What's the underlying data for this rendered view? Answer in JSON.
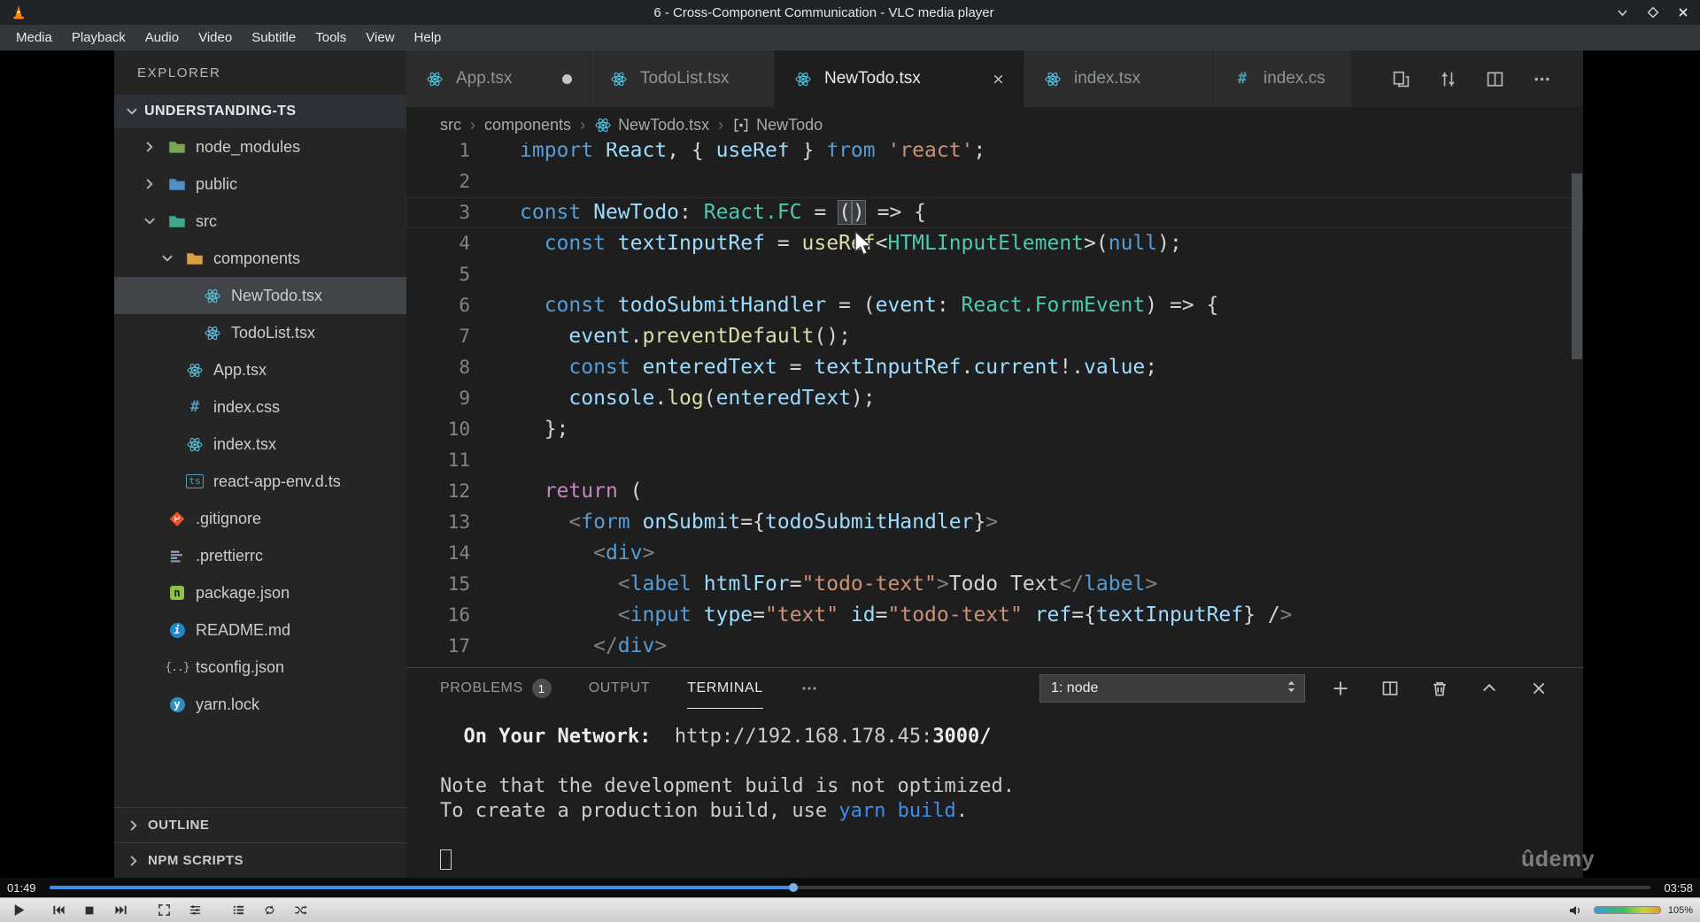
{
  "window": {
    "title": "6 - Cross-Component Communication - VLC media player",
    "buttons": [
      "minimize",
      "maximize",
      "close"
    ],
    "menus": [
      "Media",
      "Playback",
      "Audio",
      "Video",
      "Subtitle",
      "Tools",
      "View",
      "Help"
    ]
  },
  "explorer": {
    "title": "EXPLORER",
    "root": "UNDERSTANDING-TS",
    "items": [
      {
        "label": "node_modules",
        "icon": "folder-node",
        "chevron": "collapsed",
        "level": 0
      },
      {
        "label": "public",
        "icon": "folder-public",
        "chevron": "collapsed",
        "level": 0
      },
      {
        "label": "src",
        "icon": "folder-src",
        "chevron": "expanded",
        "level": 0
      },
      {
        "label": "components",
        "icon": "folder-components",
        "chevron": "expanded",
        "level": 1
      },
      {
        "label": "NewTodo.tsx",
        "icon": "react",
        "level": 2,
        "selected": true
      },
      {
        "label": "TodoList.tsx",
        "icon": "react",
        "level": 2
      },
      {
        "label": "App.tsx",
        "icon": "react",
        "level": 1
      },
      {
        "label": "index.css",
        "icon": "css",
        "level": 1
      },
      {
        "label": "index.tsx",
        "icon": "react",
        "level": 1
      },
      {
        "label": "react-app-env.d.ts",
        "icon": "ts",
        "level": 1
      },
      {
        "label": ".gitignore",
        "icon": "git",
        "level": 0
      },
      {
        "label": ".prettierrc",
        "icon": "prettier",
        "level": 0
      },
      {
        "label": "package.json",
        "icon": "npm",
        "level": 0
      },
      {
        "label": "README.md",
        "icon": "info",
        "level": 0
      },
      {
        "label": "tsconfig.json",
        "icon": "braces",
        "level": 0
      },
      {
        "label": "yarn.lock",
        "icon": "yarn",
        "level": 0
      }
    ],
    "sections": [
      "OUTLINE",
      "NPM SCRIPTS"
    ]
  },
  "tabs": [
    {
      "label": "App.tsx",
      "icon": "react",
      "modified": true
    },
    {
      "label": "TodoList.tsx",
      "icon": "react"
    },
    {
      "label": "NewTodo.tsx",
      "icon": "react",
      "active": true
    },
    {
      "label": "index.tsx",
      "icon": "react"
    },
    {
      "label": "index.cs",
      "icon": "css"
    }
  ],
  "editor_actions": [
    "open-changes-icon",
    "compare-changes-icon",
    "split-editor-icon",
    "more-actions-icon"
  ],
  "breadcrumb": [
    {
      "label": "src"
    },
    {
      "label": "components"
    },
    {
      "label": "NewTodo.tsx",
      "icon": "react"
    },
    {
      "label": "NewTodo",
      "icon": "symbol"
    }
  ],
  "breadcrumb_separator": "›",
  "code": [
    {
      "n": 1,
      "t": [
        [
          "k",
          "import "
        ],
        [
          "vr",
          "React"
        ],
        [
          "pl",
          ", { "
        ],
        [
          "vr",
          "useRef"
        ],
        [
          "pl",
          " } "
        ],
        [
          "k",
          "from"
        ],
        [
          "pl",
          " "
        ],
        [
          "st",
          "'react'"
        ],
        [
          "pl",
          ";"
        ]
      ]
    },
    {
      "n": 2,
      "t": []
    },
    {
      "n": 3,
      "cur": true,
      "t": [
        [
          "k",
          "const "
        ],
        [
          "vr",
          "NewTodo"
        ],
        [
          "pl",
          ": "
        ],
        [
          "ty",
          "React.FC"
        ],
        [
          "pl",
          " = "
        ],
        [
          "box",
          "("
        ],
        [
          "caret",
          ""
        ],
        [
          "box",
          ")"
        ],
        [
          "pl",
          " => {"
        ]
      ]
    },
    {
      "n": 4,
      "t": [
        [
          "pl",
          "  "
        ],
        [
          "k",
          "const "
        ],
        [
          "vr",
          "textInputRef"
        ],
        [
          "pl",
          " = "
        ],
        [
          "fn",
          "useRef"
        ],
        [
          "pl",
          "<"
        ],
        [
          "ty",
          "HTMLInputElement"
        ],
        [
          "pl",
          ">("
        ],
        [
          "k",
          "null"
        ],
        [
          "pl",
          ");"
        ]
      ]
    },
    {
      "n": 5,
      "t": []
    },
    {
      "n": 6,
      "t": [
        [
          "pl",
          "  "
        ],
        [
          "k",
          "const "
        ],
        [
          "vr",
          "todoSubmitHandler"
        ],
        [
          "pl",
          " = ("
        ],
        [
          "vr",
          "event"
        ],
        [
          "pl",
          ": "
        ],
        [
          "ty",
          "React.FormEvent"
        ],
        [
          "pl",
          ") => {"
        ]
      ]
    },
    {
      "n": 7,
      "t": [
        [
          "pl",
          "    "
        ],
        [
          "vr",
          "event"
        ],
        [
          "pl",
          "."
        ],
        [
          "fn",
          "preventDefault"
        ],
        [
          "pl",
          "();"
        ]
      ]
    },
    {
      "n": 8,
      "t": [
        [
          "pl",
          "    "
        ],
        [
          "k",
          "const "
        ],
        [
          "vr",
          "enteredText"
        ],
        [
          "pl",
          " = "
        ],
        [
          "vr",
          "textInputRef"
        ],
        [
          "pl",
          "."
        ],
        [
          "vr",
          "current"
        ],
        [
          "pl",
          "!."
        ],
        [
          "vr",
          "value"
        ],
        [
          "pl",
          ";"
        ]
      ]
    },
    {
      "n": 9,
      "t": [
        [
          "pl",
          "    "
        ],
        [
          "vr",
          "console"
        ],
        [
          "pl",
          "."
        ],
        [
          "fn",
          "log"
        ],
        [
          "pl",
          "("
        ],
        [
          "vr",
          "enteredText"
        ],
        [
          "pl",
          ");"
        ]
      ]
    },
    {
      "n": 10,
      "t": [
        [
          "pl",
          "  };"
        ]
      ]
    },
    {
      "n": 11,
      "t": []
    },
    {
      "n": 12,
      "t": [
        [
          "pl",
          "  "
        ],
        [
          "rt",
          "return"
        ],
        [
          "pl",
          " ("
        ]
      ]
    },
    {
      "n": 13,
      "t": [
        [
          "pl",
          "    "
        ],
        [
          "br",
          "<"
        ],
        [
          "tg",
          "form"
        ],
        [
          "pl",
          " "
        ],
        [
          "vr",
          "onSubmit"
        ],
        [
          "pl",
          "={"
        ],
        [
          "vr",
          "todoSubmitHandler"
        ],
        [
          "pl",
          "}"
        ],
        [
          "br",
          ">"
        ]
      ]
    },
    {
      "n": 14,
      "t": [
        [
          "pl",
          "      "
        ],
        [
          "br",
          "<"
        ],
        [
          "tg",
          "div"
        ],
        [
          "br",
          ">"
        ]
      ]
    },
    {
      "n": 15,
      "t": [
        [
          "pl",
          "        "
        ],
        [
          "br",
          "<"
        ],
        [
          "tg",
          "label"
        ],
        [
          "pl",
          " "
        ],
        [
          "vr",
          "htmlFor"
        ],
        [
          "pl",
          "="
        ],
        [
          "st",
          "\"todo-text\""
        ],
        [
          "br",
          ">"
        ],
        [
          "pl",
          "Todo Text"
        ],
        [
          "br",
          "</"
        ],
        [
          "tg",
          "label"
        ],
        [
          "br",
          ">"
        ]
      ]
    },
    {
      "n": 16,
      "t": [
        [
          "pl",
          "        "
        ],
        [
          "br",
          "<"
        ],
        [
          "tg",
          "input"
        ],
        [
          "pl",
          " "
        ],
        [
          "vr",
          "type"
        ],
        [
          "pl",
          "="
        ],
        [
          "st",
          "\"text\""
        ],
        [
          "pl",
          " "
        ],
        [
          "vr",
          "id"
        ],
        [
          "pl",
          "="
        ],
        [
          "st",
          "\"todo-text\""
        ],
        [
          "pl",
          " "
        ],
        [
          "vr",
          "ref"
        ],
        [
          "pl",
          "={"
        ],
        [
          "vr",
          "textInputRef"
        ],
        [
          "pl",
          "} /"
        ],
        [
          "br",
          ">"
        ]
      ]
    },
    {
      "n": 17,
      "t": [
        [
          "pl",
          "      "
        ],
        [
          "br",
          "</"
        ],
        [
          "tg",
          "div"
        ],
        [
          "br",
          ">"
        ]
      ]
    }
  ],
  "panel": {
    "tabs": [
      {
        "label": "PROBLEMS",
        "badge": "1"
      },
      {
        "label": "OUTPUT"
      },
      {
        "label": "TERMINAL",
        "active": true
      }
    ],
    "dropdown": "1: node",
    "actions": [
      "new-terminal-icon",
      "split-terminal-icon",
      "kill-terminal-icon",
      "maximize-panel-icon",
      "close-panel-icon"
    ],
    "terminal": [
      [
        [
          "pl",
          "  "
        ],
        [
          "b",
          "On Your Network:"
        ],
        [
          "pl",
          "  http://192.168.178.45:"
        ],
        [
          "b",
          "3000/"
        ]
      ],
      [],
      [
        [
          "pl",
          "Note that the development build is not optimized."
        ]
      ],
      [
        [
          "pl",
          "To create a production build, use "
        ],
        [
          "l",
          "yarn build"
        ],
        [
          "pl",
          "."
        ]
      ],
      [],
      [
        [
          "cursor",
          ""
        ]
      ]
    ]
  },
  "player": {
    "time_elapsed": "01:49",
    "time_total": "03:58",
    "progress_percent": 46.5,
    "controls": [
      "play",
      "previous",
      "stop",
      "next",
      "fullscreen",
      "extended-settings",
      "playlist",
      "loop",
      "random"
    ],
    "volume_percent": "105%",
    "watermark": "ûdemy",
    "accent_blue": "#3f8fe8"
  }
}
